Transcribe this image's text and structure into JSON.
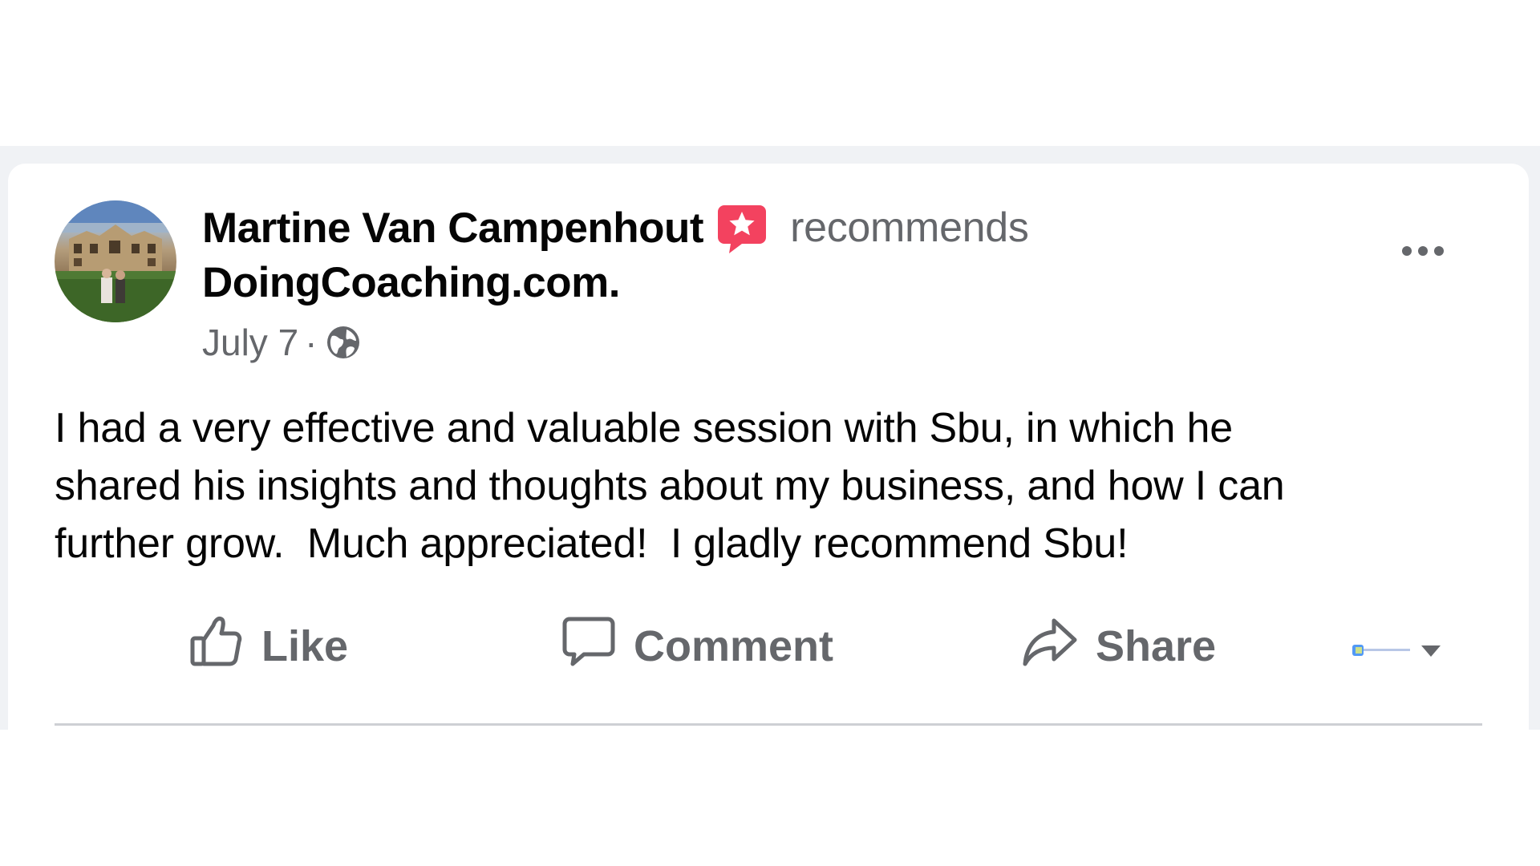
{
  "post": {
    "author": {
      "name": "Martine Van Campenhout",
      "avatar_icon": "profile-photo",
      "recommend_icon": "recommend-badge-icon"
    },
    "verb": "recommends",
    "page_name": "DoingCoaching.com.",
    "meta": {
      "date": "July 7",
      "separator": "·",
      "privacy_icon": "globe-icon"
    },
    "more_icon": "more-options-icon",
    "body": "I had a very effective and valuable session with Sbu, in which he\nshared his insights and thoughts about my business, and how I can\nfurther grow.  Much appreciated!  I gladly recommend Sbu!",
    "actions": [
      {
        "label": "Like",
        "icon": "thumbs-up-icon"
      },
      {
        "label": "Comment",
        "icon": "comment-icon"
      },
      {
        "label": "Share",
        "icon": "share-icon"
      }
    ],
    "audience_selector_icon": "chevron-down-icon"
  },
  "colors": {
    "feed_background": "#f0f2f5",
    "card_background": "#ffffff",
    "primary_text": "#050505",
    "secondary_text": "#65676b",
    "recommend_badge": "#f3425f",
    "divider": "#ced0d4"
  }
}
